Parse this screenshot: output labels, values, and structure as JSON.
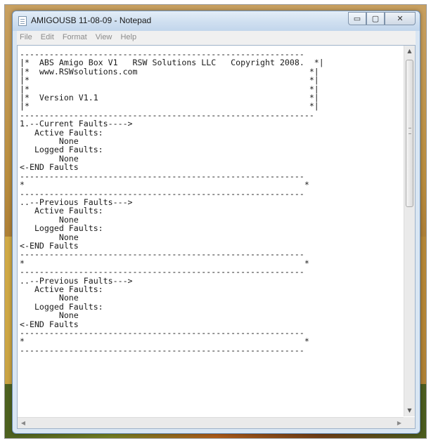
{
  "window": {
    "title": "AMIGOUSB 11-08-09 - Notepad",
    "minimize_label": "▭",
    "maximize_label": "▢",
    "close_label": "✕"
  },
  "menu": [
    "File",
    "Edit",
    "Format",
    "View",
    "Help"
  ],
  "document": {
    "lines": [
      "----------------------------------------------------------",
      "|*  ABS Amigo Box V1   RSW Solutions LLC   Copyright 2008.  *|",
      "|*  www.RSWsolutions.com                                   *|",
      "|*                                                         *|",
      "|*                                                         *|",
      "|*  Version V1.1                                           *|",
      "|*                                                         *|",
      "------------------------------------------------------------",
      "1.--Current Faults---->",
      "   Active Faults:",
      "        None",
      "   Logged Faults:",
      "        None",
      "<-END Faults",
      "----------------------------------------------------------",
      "*                                                         *",
      "----------------------------------------------------------",
      "..--Previous Faults--->",
      "   Active Faults:",
      "        None",
      "   Logged Faults:",
      "        None",
      "<-END Faults",
      "----------------------------------------------------------",
      "*                                                         *",
      "----------------------------------------------------------",
      "..--Previous Faults--->",
      "   Active Faults:",
      "        None",
      "   Logged Faults:",
      "        None",
      "<-END Faults",
      "----------------------------------------------------------",
      "*                                                         *",
      "----------------------------------------------------------"
    ]
  },
  "scrollbar": {
    "up_icon": "▲",
    "down_icon": "▼",
    "left_icon": "◀",
    "right_icon": "▶"
  },
  "colors": {
    "title_bar": "#cfdff0",
    "text": "#1a1a1a",
    "menu_text": "#8a8a8a"
  }
}
